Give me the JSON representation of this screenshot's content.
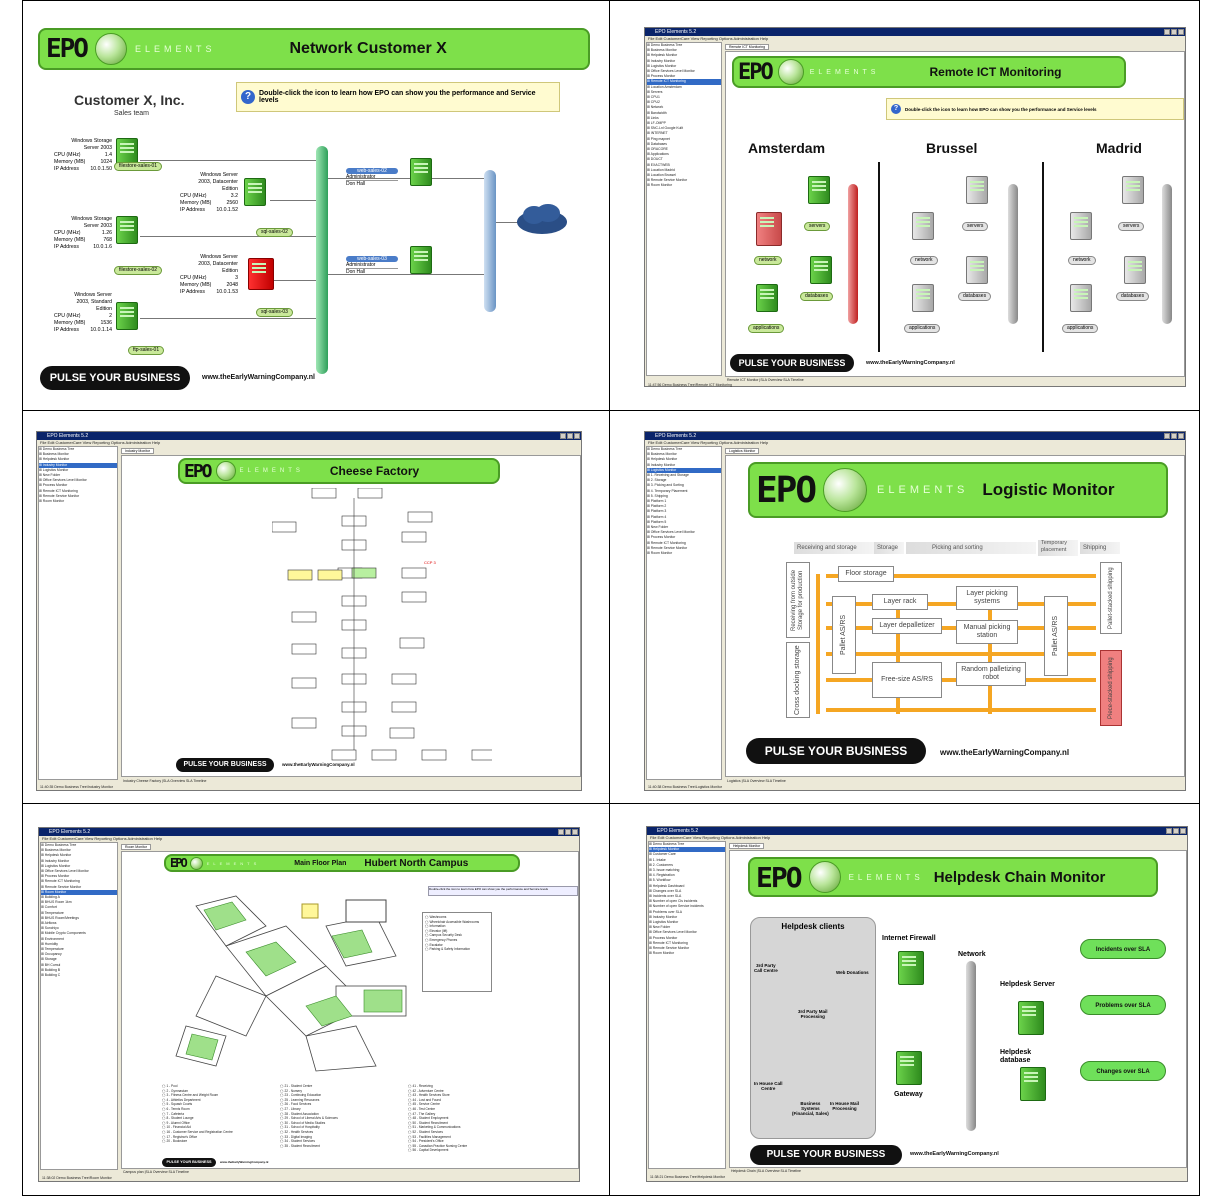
{
  "colors": {
    "banner_green": "#7ee04a",
    "server_green": "#3fb52a",
    "alert_red": "#e00000",
    "pipe_green": "#43c06a",
    "pipe_blue": "#7aa7d6",
    "pipe_grey": "#9a9a9a",
    "pipe_red": "#d43030",
    "flow_orange": "#f5a623"
  },
  "common": {
    "epo_logo": "EPO",
    "elements": "ELEMENTS",
    "pulse": "PULSE YOUR BUSINESS",
    "website": "www.theEarlyWarningCompany.nl",
    "hint": "Double-click the icon to learn how EPO can show you the performance and Service levels",
    "app_title": "EPO Elements 5.2",
    "menu": "File  Edit  CustomerCare  View  Reporting  Options  Administration  Help"
  },
  "panel1": {
    "title": "Network Customer X",
    "company": "Customer X, Inc.",
    "team": "Sales team",
    "servers": [
      {
        "name": "Windows Storage\nServer 2003",
        "cpu_l": "CPU (MHz)",
        "cpu": "1.4",
        "mem_l": "Memory (MB)",
        "mem": "1024",
        "ip_l": "IP Address",
        "ip": "10.0.1.50",
        "tag": "filestore-sales-01"
      },
      {
        "name": "Windows Storage\nServer 2003",
        "cpu_l": "CPU (MHz)",
        "cpu": "1.26",
        "mem_l": "Memory (MB)",
        "mem": "768",
        "ip_l": "IP Address",
        "ip": "10.0.1.6",
        "tag": "filestore-sales-02"
      },
      {
        "name": "Windows Server\n2003, Standard\nEdition",
        "cpu_l": "CPU (MHz)",
        "cpu": "2",
        "mem_l": "Memory (MB)",
        "mem": "1536",
        "ip_l": "IP Address",
        "ip": "10.0.1.14",
        "tag": "ftp-sales-01"
      },
      {
        "name": "Windows Server\n2003, Datacenter\nEdition",
        "cpu_l": "CPU (MHz)",
        "cpu": "3.2",
        "mem_l": "Memory (MB)",
        "mem": "2560",
        "ip_l": "IP Address",
        "ip": "10.0.1.52",
        "tag": "sql-sales-02"
      },
      {
        "name": "Windows Server\n2003, Datacenter\nEdition",
        "cpu_l": "CPU (MHz)",
        "cpu": "3",
        "mem_l": "Memory (MB)",
        "mem": "2048",
        "ip_l": "IP Address",
        "ip": "10.0.1.53",
        "tag": "sql-sales-03"
      }
    ],
    "web": [
      {
        "name": "web-sales-02",
        "r1": "Administrator",
        "r2": "Don Hall"
      },
      {
        "name": "web-sales-03",
        "r1": "Administrator",
        "r2": "Don Hall"
      }
    ]
  },
  "panel2": {
    "tab": "Remote ICT Monitoring",
    "title": "Remote ICT Monitoring",
    "cities": [
      "Amsterdam",
      "Brussel",
      "Madrid"
    ],
    "labels": {
      "servers": "servers",
      "network": "network",
      "databases": "databases",
      "applications": "applications"
    },
    "tree": [
      "Demo Business Tree",
      "Business Monitor",
      "Helpdesk Monitor",
      "Industry Monitor",
      "Logistics Monitor",
      "Office Services Level Monitor",
      "Process Monitor",
      "Remote ICT Monitoring",
      "Location Amsterdam",
      "Servers",
      "CPU1",
      "CPU2",
      "Network",
      "Bandwidth",
      "Links",
      "LF-OMPP",
      "SNC-Lnl Google Kuilt",
      "INTERNET",
      "Ping mapnet",
      "Databases",
      "ORACORE",
      "Applications",
      "DOUCT",
      "EXACTWEB",
      "Location Madrid",
      "Location Brussel",
      "Remote Service Monitor",
      "Room Monitor"
    ],
    "status": "11:47:56   Demo Business Tree\\Remote ICT Monitoring",
    "bottom_tabs": "Remote ICT Monitor  |SLA  Overview  SLA  Timeline"
  },
  "panel3": {
    "tab": "Industry Monitor",
    "title": "Cheese Factory",
    "tree": [
      "Demo Business Tree",
      "Business Monitor",
      "Helpdesk Monitor",
      "Industry Monitor",
      "Logistics Monitor",
      "New Folder",
      "Office Services Level Monitor",
      "Process Monitor",
      "Remote ICT Monitoring",
      "Remote Service Monitor",
      "Room Monitor"
    ],
    "status": "11:40:35   Demo Business Tree\\Industry Monitor",
    "bottom_tabs": "Industry Cheese Factory  |SLA  Overview  SLA  Timeline",
    "ccp": "CCP 3"
  },
  "panel4": {
    "tab": "Logistics Monitor",
    "title": "Logistic Monitor",
    "stages": [
      "Receiving and storage",
      "Storage",
      "Picking and sorting",
      "Temporary placement",
      "Shipping"
    ],
    "boxes": {
      "receiving": "Receiving from outside Storage for production",
      "floor": "Floor storage",
      "layer_rack": "Layer rack",
      "layer_picking": "Layer picking systems",
      "pallet_asrs_1": "Pallet AS/RS",
      "layer_depal": "Layer depalletizer",
      "manual": "Manual picking station",
      "cross": "Cross docking storage",
      "free": "Free-size AS/RS",
      "random": "Random palletizing robot",
      "pallet_asrs_2": "Pallet AS/RS",
      "pallet_stacked": "Pallet-stacked shipping",
      "piece_stacked": "Piece-stacked shipping"
    },
    "tree": [
      "Demo Business Tree",
      "Business Monitor",
      "Helpdesk Monitor",
      "Industry Monitor",
      "Logistics Monitor",
      "1. Receiving and Storage",
      "2. Storage",
      "3. Picking and Sorting",
      "4. Temporary Placement",
      "5. Shipping",
      "Platform 1",
      "Platform 2",
      "Platform 3",
      "Platform 4",
      "Platform 5",
      "New Folder",
      "Office Services Level Monitor",
      "Process Monitor",
      "Remote ICT Monitoring",
      "Remote Service Monitor",
      "Room Monitor"
    ],
    "status": "11:40:38   Demo Business Tree\\Logistics Monitor",
    "bottom_tabs": "Logistics  |SLA  Overview  SLA  Timeline"
  },
  "panel5": {
    "tab": "Room Monitor",
    "title1": "Main Floor Plan",
    "title2": "Hubert North Campus",
    "tree": [
      "Demo Business Tree",
      "Business Monitor",
      "Helpdesk Monitor",
      "Industry Monitor",
      "Logistics Monitor",
      "Office Services Level Monitor",
      "Process Monitor",
      "Remote ICT Monitoring",
      "Remote Service Monitor",
      "Room Monitor",
      "Building A",
      "BHUS Room 1km",
      "Comfort",
      "Temperature",
      "BHUS Room/Meetings",
      "Airflows",
      "Sunchiyo",
      "Mobile Crypto Components",
      "Environment",
      "Humidity",
      "Temperature",
      "Occupancy",
      "Storage",
      "BH Cumul",
      "Building B",
      "Building C"
    ],
    "status": "11:38:02   Demo Business Tree\\Room Monitor",
    "bottom_tabs": "Campus plan  |SLA  Overview  SLA  Timeline",
    "legend": [
      "Washrooms",
      "Wheelchair Accessible Washrooms",
      "Information",
      "Elevator (lift)",
      "Campus Security Desk",
      "Emergency Phones",
      "Escalator",
      "Parking & Safety Information"
    ],
    "list1": [
      "1 - Pool",
      "2 - Gymnasium",
      "3 - Fitness Centre and Weight Room",
      "4 - Athletics Department",
      "5 - Squash Courts",
      "6 - Tennis Room",
      "7 - Cafeteria",
      "8 - Student Lounge",
      "9 - Alumni Office",
      "10 - Financial Aid",
      "16 - Customer Service and Registration Centre",
      "17 - Registrar's Office",
      "20 - Bookstore"
    ],
    "list2": [
      "21 - Student Centre",
      "22 - Nursery",
      "23 - Continuing Education",
      "25 - Learning Resources",
      "26 - Food Services",
      "27 - Library",
      "28 - Student Association",
      "29 - School of Liberal Arts & Sciences",
      "30 - School of Media Studies",
      "31 - School of Hospitality",
      "32 - Health Services",
      "33 - Digital Imaging",
      "34 - Student Services",
      "35 - Student Recruitment"
    ],
    "list3": [
      "41 - Receiving",
      "42 - Adventure Centre",
      "43 - Health Services Store",
      "44 - Lost and Found",
      "45 - Service Centre",
      "46 - Test Centre",
      "47 - The Gallery",
      "48 - Student Employment",
      "50 - Student Recruitment",
      "51 - Marketing & Communications",
      "52 - Student Services",
      "53 - Facilities Management",
      "54 - President's Office",
      "55 - Canadian Practice Nursing Centre",
      "56 - Capital Development"
    ]
  },
  "panel6": {
    "tab": "Helpdesk Monitor",
    "title": "Helpdesk Chain Monitor",
    "clients_title": "Helpdesk clients",
    "clients": [
      "3rd Party\nCall Centre",
      "Web Donations",
      "3rd Party Mail\nProcessing",
      "In House Call\nCentre",
      "Business\nSystems\n(Financial, Sales)",
      "In House Mail\nProcessing"
    ],
    "firewall": "Internet Firewall",
    "network": "Network",
    "server": "Helpdesk Server",
    "database": "Helpdesk\ndatabase",
    "gateway": "Gateway",
    "pills": [
      "Incidents over SLA",
      "Problems over SLA",
      "Changes over SLA"
    ],
    "tree": [
      "Demo Business Tree",
      "Helpdesk Monitor",
      "Customer Care",
      "1. Intake",
      "2. Customers",
      "3. Issue matching",
      "4. Registration",
      "5. Workflow",
      "Helpdesk Dashboard",
      "Changes over SLA",
      "Incidents over SLA",
      "Number of open Cls incidents",
      "Number of open Service incidents",
      "Problems over SLA",
      "Industry Monitor",
      "Logistics Monitor",
      "New Folder",
      "Office Services Level Monitor",
      "Process Monitor",
      "Remote ICT Monitoring",
      "Remote Service Monitor",
      "Room Monitor"
    ],
    "status": "11:38:21   Demo Business Tree\\Helpdesk Monitor",
    "bottom_tabs": "Helpdesk Chain  |SLA  Overview  SLA  Timeline"
  }
}
